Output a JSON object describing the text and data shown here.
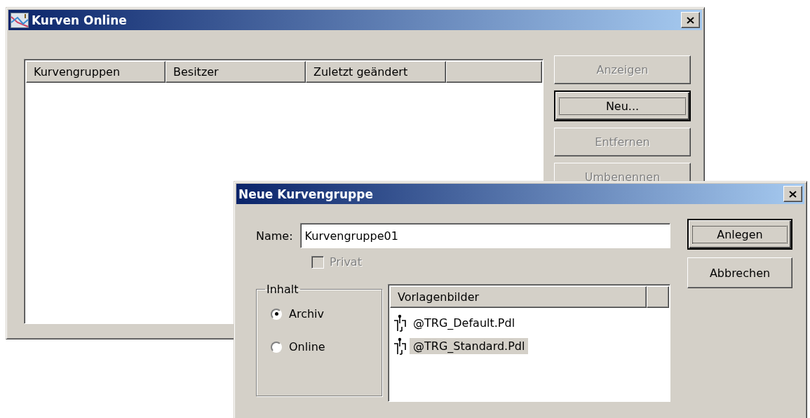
{
  "main_window": {
    "title": "Kurven Online",
    "list": {
      "columns": [
        "Kurvengruppen",
        "Besitzer",
        "Zuletzt geändert"
      ]
    },
    "buttons": [
      {
        "label": "Anzeigen",
        "disabled": true,
        "default": false
      },
      {
        "label": "Neu...",
        "disabled": false,
        "default": true
      },
      {
        "label": "Entfernen",
        "disabled": true,
        "default": false
      },
      {
        "label": "Umbenennen",
        "disabled": true,
        "default": false
      }
    ]
  },
  "dialog": {
    "title": "Neue Kurvengruppe",
    "name_label": "Name:",
    "name_value": "Kurvengruppe01",
    "privat": {
      "label": "Privat",
      "checked": false,
      "disabled": true
    },
    "inhalt": {
      "title": "Inhalt",
      "options": [
        {
          "label": "Archiv",
          "selected": true
        },
        {
          "label": "Online",
          "selected": false
        }
      ]
    },
    "templates": {
      "columns": [
        "Vorlagenbilder"
      ],
      "items": [
        {
          "label": "@TRG_Default.Pdl",
          "selected": false
        },
        {
          "label": "@TRG_Standard.Pdl",
          "selected": true
        }
      ]
    },
    "buttons": [
      {
        "label": "Anlegen",
        "disabled": false,
        "default": true
      },
      {
        "label": "Abbrechen",
        "disabled": false,
        "default": false
      }
    ]
  }
}
